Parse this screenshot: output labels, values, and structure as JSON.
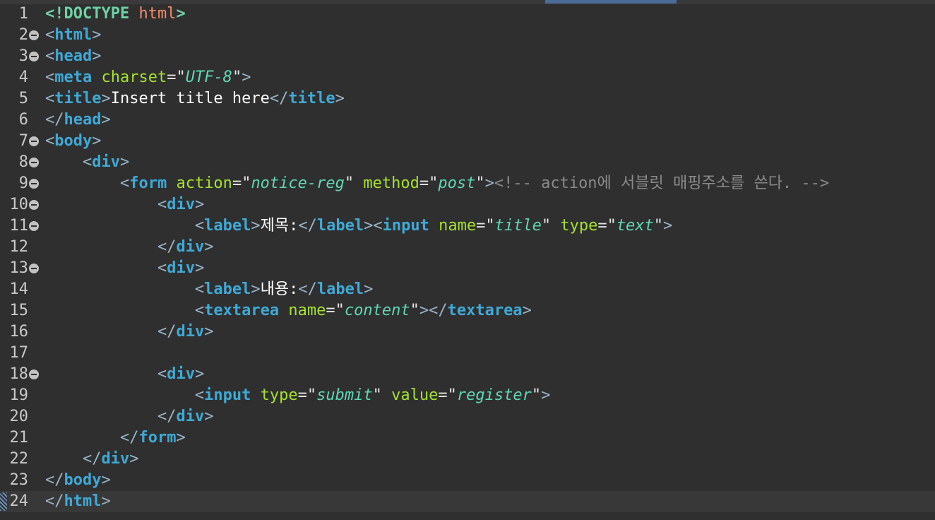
{
  "editor": {
    "language": "html",
    "current_line": 24,
    "colors": {
      "background": "#2f2f2f",
      "tag": "#3fa9d6",
      "attribute": "#a6e22e",
      "value": "#5fd7b5",
      "comment": "#8a8a8a",
      "text": "#ffffff"
    },
    "lines": [
      {
        "n": "1",
        "fold": false,
        "tokens": [
          [
            "doctype",
            "<!DOCTYPE"
          ],
          [
            "plain",
            " "
          ],
          [
            "doctype-word",
            "html"
          ],
          [
            "doctype",
            ">"
          ]
        ]
      },
      {
        "n": "2",
        "fold": true,
        "tokens": [
          [
            "bracket",
            "<"
          ],
          [
            "tag",
            "html"
          ],
          [
            "bracket",
            ">"
          ]
        ]
      },
      {
        "n": "3",
        "fold": true,
        "tokens": [
          [
            "bracket",
            "<"
          ],
          [
            "tag",
            "head"
          ],
          [
            "bracket",
            ">"
          ]
        ]
      },
      {
        "n": "4",
        "fold": false,
        "tokens": [
          [
            "bracket",
            "<"
          ],
          [
            "tag",
            "meta"
          ],
          [
            "plain",
            " "
          ],
          [
            "attr",
            "charset"
          ],
          [
            "eq",
            "="
          ],
          [
            "quote",
            "\""
          ],
          [
            "val",
            "UTF-8"
          ],
          [
            "quote",
            "\""
          ],
          [
            "bracket",
            ">"
          ]
        ]
      },
      {
        "n": "5",
        "fold": false,
        "tokens": [
          [
            "bracket",
            "<"
          ],
          [
            "tag",
            "title"
          ],
          [
            "bracket",
            ">"
          ],
          [
            "text",
            "Insert title here"
          ],
          [
            "bracket",
            "</"
          ],
          [
            "tag",
            "title"
          ],
          [
            "bracket",
            ">"
          ]
        ]
      },
      {
        "n": "6",
        "fold": false,
        "tokens": [
          [
            "bracket",
            "</"
          ],
          [
            "tag",
            "head"
          ],
          [
            "bracket",
            ">"
          ]
        ]
      },
      {
        "n": "7",
        "fold": true,
        "tokens": [
          [
            "bracket",
            "<"
          ],
          [
            "tag",
            "body"
          ],
          [
            "bracket",
            ">"
          ]
        ]
      },
      {
        "n": "8",
        "fold": true,
        "tokens": [
          [
            "plain",
            "    "
          ],
          [
            "bracket",
            "<"
          ],
          [
            "tag",
            "div"
          ],
          [
            "bracket",
            ">"
          ]
        ]
      },
      {
        "n": "9",
        "fold": true,
        "tokens": [
          [
            "plain",
            "        "
          ],
          [
            "bracket",
            "<"
          ],
          [
            "tag",
            "form"
          ],
          [
            "plain",
            " "
          ],
          [
            "attr",
            "action"
          ],
          [
            "eq",
            "="
          ],
          [
            "quote",
            "\""
          ],
          [
            "val",
            "notice-reg"
          ],
          [
            "quote",
            "\""
          ],
          [
            "plain",
            " "
          ],
          [
            "attr",
            "method"
          ],
          [
            "eq",
            "="
          ],
          [
            "quote",
            "\""
          ],
          [
            "val",
            "post"
          ],
          [
            "quote",
            "\""
          ],
          [
            "bracket",
            ">"
          ],
          [
            "comment",
            "<!-- action에 서블릿 매핑주소를 쓴다. -->"
          ]
        ]
      },
      {
        "n": "10",
        "fold": true,
        "tokens": [
          [
            "plain",
            "            "
          ],
          [
            "bracket",
            "<"
          ],
          [
            "tag",
            "div"
          ],
          [
            "bracket",
            ">"
          ]
        ]
      },
      {
        "n": "11",
        "fold": true,
        "tokens": [
          [
            "plain",
            "                "
          ],
          [
            "bracket",
            "<"
          ],
          [
            "tag",
            "label"
          ],
          [
            "bracket",
            ">"
          ],
          [
            "text",
            "제목:"
          ],
          [
            "bracket",
            "</"
          ],
          [
            "tag",
            "label"
          ],
          [
            "bracket",
            "><"
          ],
          [
            "tag",
            "input"
          ],
          [
            "plain",
            " "
          ],
          [
            "attr",
            "name"
          ],
          [
            "eq",
            "="
          ],
          [
            "quote",
            "\""
          ],
          [
            "val",
            "title"
          ],
          [
            "quote",
            "\""
          ],
          [
            "plain",
            " "
          ],
          [
            "attr",
            "type"
          ],
          [
            "eq",
            "="
          ],
          [
            "quote",
            "\""
          ],
          [
            "val",
            "text"
          ],
          [
            "quote",
            "\""
          ],
          [
            "bracket",
            ">"
          ]
        ]
      },
      {
        "n": "12",
        "fold": false,
        "tokens": [
          [
            "plain",
            "            "
          ],
          [
            "bracket",
            "</"
          ],
          [
            "tag",
            "div"
          ],
          [
            "bracket",
            ">"
          ]
        ]
      },
      {
        "n": "13",
        "fold": true,
        "tokens": [
          [
            "plain",
            "            "
          ],
          [
            "bracket",
            "<"
          ],
          [
            "tag",
            "div"
          ],
          [
            "bracket",
            ">"
          ]
        ]
      },
      {
        "n": "14",
        "fold": false,
        "tokens": [
          [
            "plain",
            "                "
          ],
          [
            "bracket",
            "<"
          ],
          [
            "tag",
            "label"
          ],
          [
            "bracket",
            ">"
          ],
          [
            "text",
            "내용:"
          ],
          [
            "bracket",
            "</"
          ],
          [
            "tag",
            "label"
          ],
          [
            "bracket",
            ">"
          ]
        ]
      },
      {
        "n": "15",
        "fold": false,
        "tokens": [
          [
            "plain",
            "                "
          ],
          [
            "bracket",
            "<"
          ],
          [
            "tag",
            "textarea"
          ],
          [
            "plain",
            " "
          ],
          [
            "attr",
            "name"
          ],
          [
            "eq",
            "="
          ],
          [
            "quote",
            "\""
          ],
          [
            "val",
            "content"
          ],
          [
            "quote",
            "\""
          ],
          [
            "bracket",
            "></"
          ],
          [
            "tag",
            "textarea"
          ],
          [
            "bracket",
            ">"
          ]
        ]
      },
      {
        "n": "16",
        "fold": false,
        "tokens": [
          [
            "plain",
            "            "
          ],
          [
            "bracket",
            "</"
          ],
          [
            "tag",
            "div"
          ],
          [
            "bracket",
            ">"
          ]
        ]
      },
      {
        "n": "17",
        "fold": false,
        "tokens": []
      },
      {
        "n": "18",
        "fold": true,
        "tokens": [
          [
            "plain",
            "            "
          ],
          [
            "bracket",
            "<"
          ],
          [
            "tag",
            "div"
          ],
          [
            "bracket",
            ">"
          ]
        ]
      },
      {
        "n": "19",
        "fold": false,
        "tokens": [
          [
            "plain",
            "                "
          ],
          [
            "bracket",
            "<"
          ],
          [
            "tag",
            "input"
          ],
          [
            "plain",
            " "
          ],
          [
            "attr",
            "type"
          ],
          [
            "eq",
            "="
          ],
          [
            "quote",
            "\""
          ],
          [
            "val",
            "submit"
          ],
          [
            "quote",
            "\""
          ],
          [
            "plain",
            " "
          ],
          [
            "attr",
            "value"
          ],
          [
            "eq",
            "="
          ],
          [
            "quote",
            "\""
          ],
          [
            "val",
            "register"
          ],
          [
            "quote",
            "\""
          ],
          [
            "bracket",
            ">"
          ]
        ]
      },
      {
        "n": "20",
        "fold": false,
        "tokens": [
          [
            "plain",
            "            "
          ],
          [
            "bracket",
            "</"
          ],
          [
            "tag",
            "div"
          ],
          [
            "bracket",
            ">"
          ]
        ]
      },
      {
        "n": "21",
        "fold": false,
        "tokens": [
          [
            "plain",
            "        "
          ],
          [
            "bracket",
            "</"
          ],
          [
            "tag",
            "form"
          ],
          [
            "bracket",
            ">"
          ]
        ]
      },
      {
        "n": "22",
        "fold": false,
        "tokens": [
          [
            "plain",
            "    "
          ],
          [
            "bracket",
            "</"
          ],
          [
            "tag",
            "div"
          ],
          [
            "bracket",
            ">"
          ]
        ]
      },
      {
        "n": "23",
        "fold": false,
        "tokens": [
          [
            "bracket",
            "</"
          ],
          [
            "tag",
            "body"
          ],
          [
            "bracket",
            ">"
          ]
        ]
      },
      {
        "n": "24",
        "fold": false,
        "tokens": [
          [
            "bracket",
            "</"
          ],
          [
            "tag",
            "html"
          ],
          [
            "bracket",
            ">"
          ]
        ]
      }
    ]
  }
}
